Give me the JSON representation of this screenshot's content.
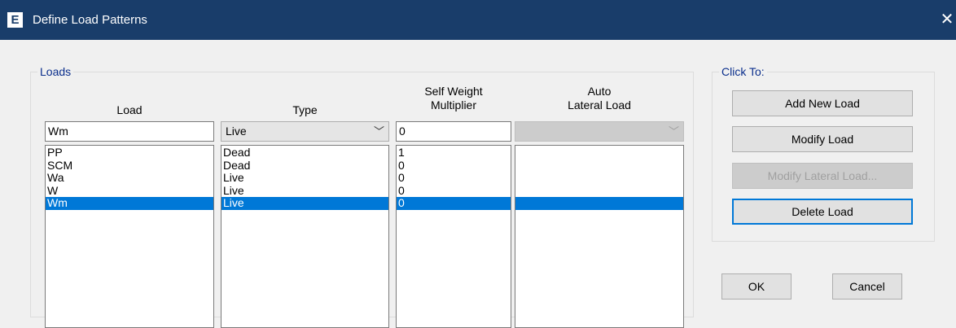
{
  "window": {
    "app_icon_glyph": "E",
    "title": "Define Load Patterns",
    "close_glyph": "✕"
  },
  "loads_group": {
    "label": "Loads",
    "headers": {
      "load": "Load",
      "type": "Type",
      "self_weight_line1": "Self Weight",
      "self_weight_line2": "Multiplier",
      "auto_lateral_line1": "Auto",
      "auto_lateral_line2": "Lateral Load"
    },
    "inputs": {
      "load_name": "Wm",
      "type": "Live",
      "self_weight_multiplier": "0",
      "auto_lateral_load": ""
    },
    "rows": [
      {
        "load": "PP",
        "type": "Dead",
        "multiplier": "1",
        "auto_lateral": ""
      },
      {
        "load": "SCM",
        "type": "Dead",
        "multiplier": "0",
        "auto_lateral": ""
      },
      {
        "load": "Wa",
        "type": "Live",
        "multiplier": "0",
        "auto_lateral": ""
      },
      {
        "load": "W",
        "type": "Live",
        "multiplier": "0",
        "auto_lateral": ""
      },
      {
        "load": "Wm",
        "type": "Live",
        "multiplier": "0",
        "auto_lateral": ""
      }
    ]
  },
  "click_to_group": {
    "label": "Click To:",
    "add_new_load": "Add New Load",
    "modify_load": "Modify Load",
    "modify_lateral_load": "Modify Lateral Load...",
    "delete_load": "Delete Load"
  },
  "footer": {
    "ok": "OK",
    "cancel": "Cancel"
  },
  "colors": {
    "titlebar": "#193d6a",
    "selection": "#0078d7",
    "group_label": "#0a2e8c"
  }
}
